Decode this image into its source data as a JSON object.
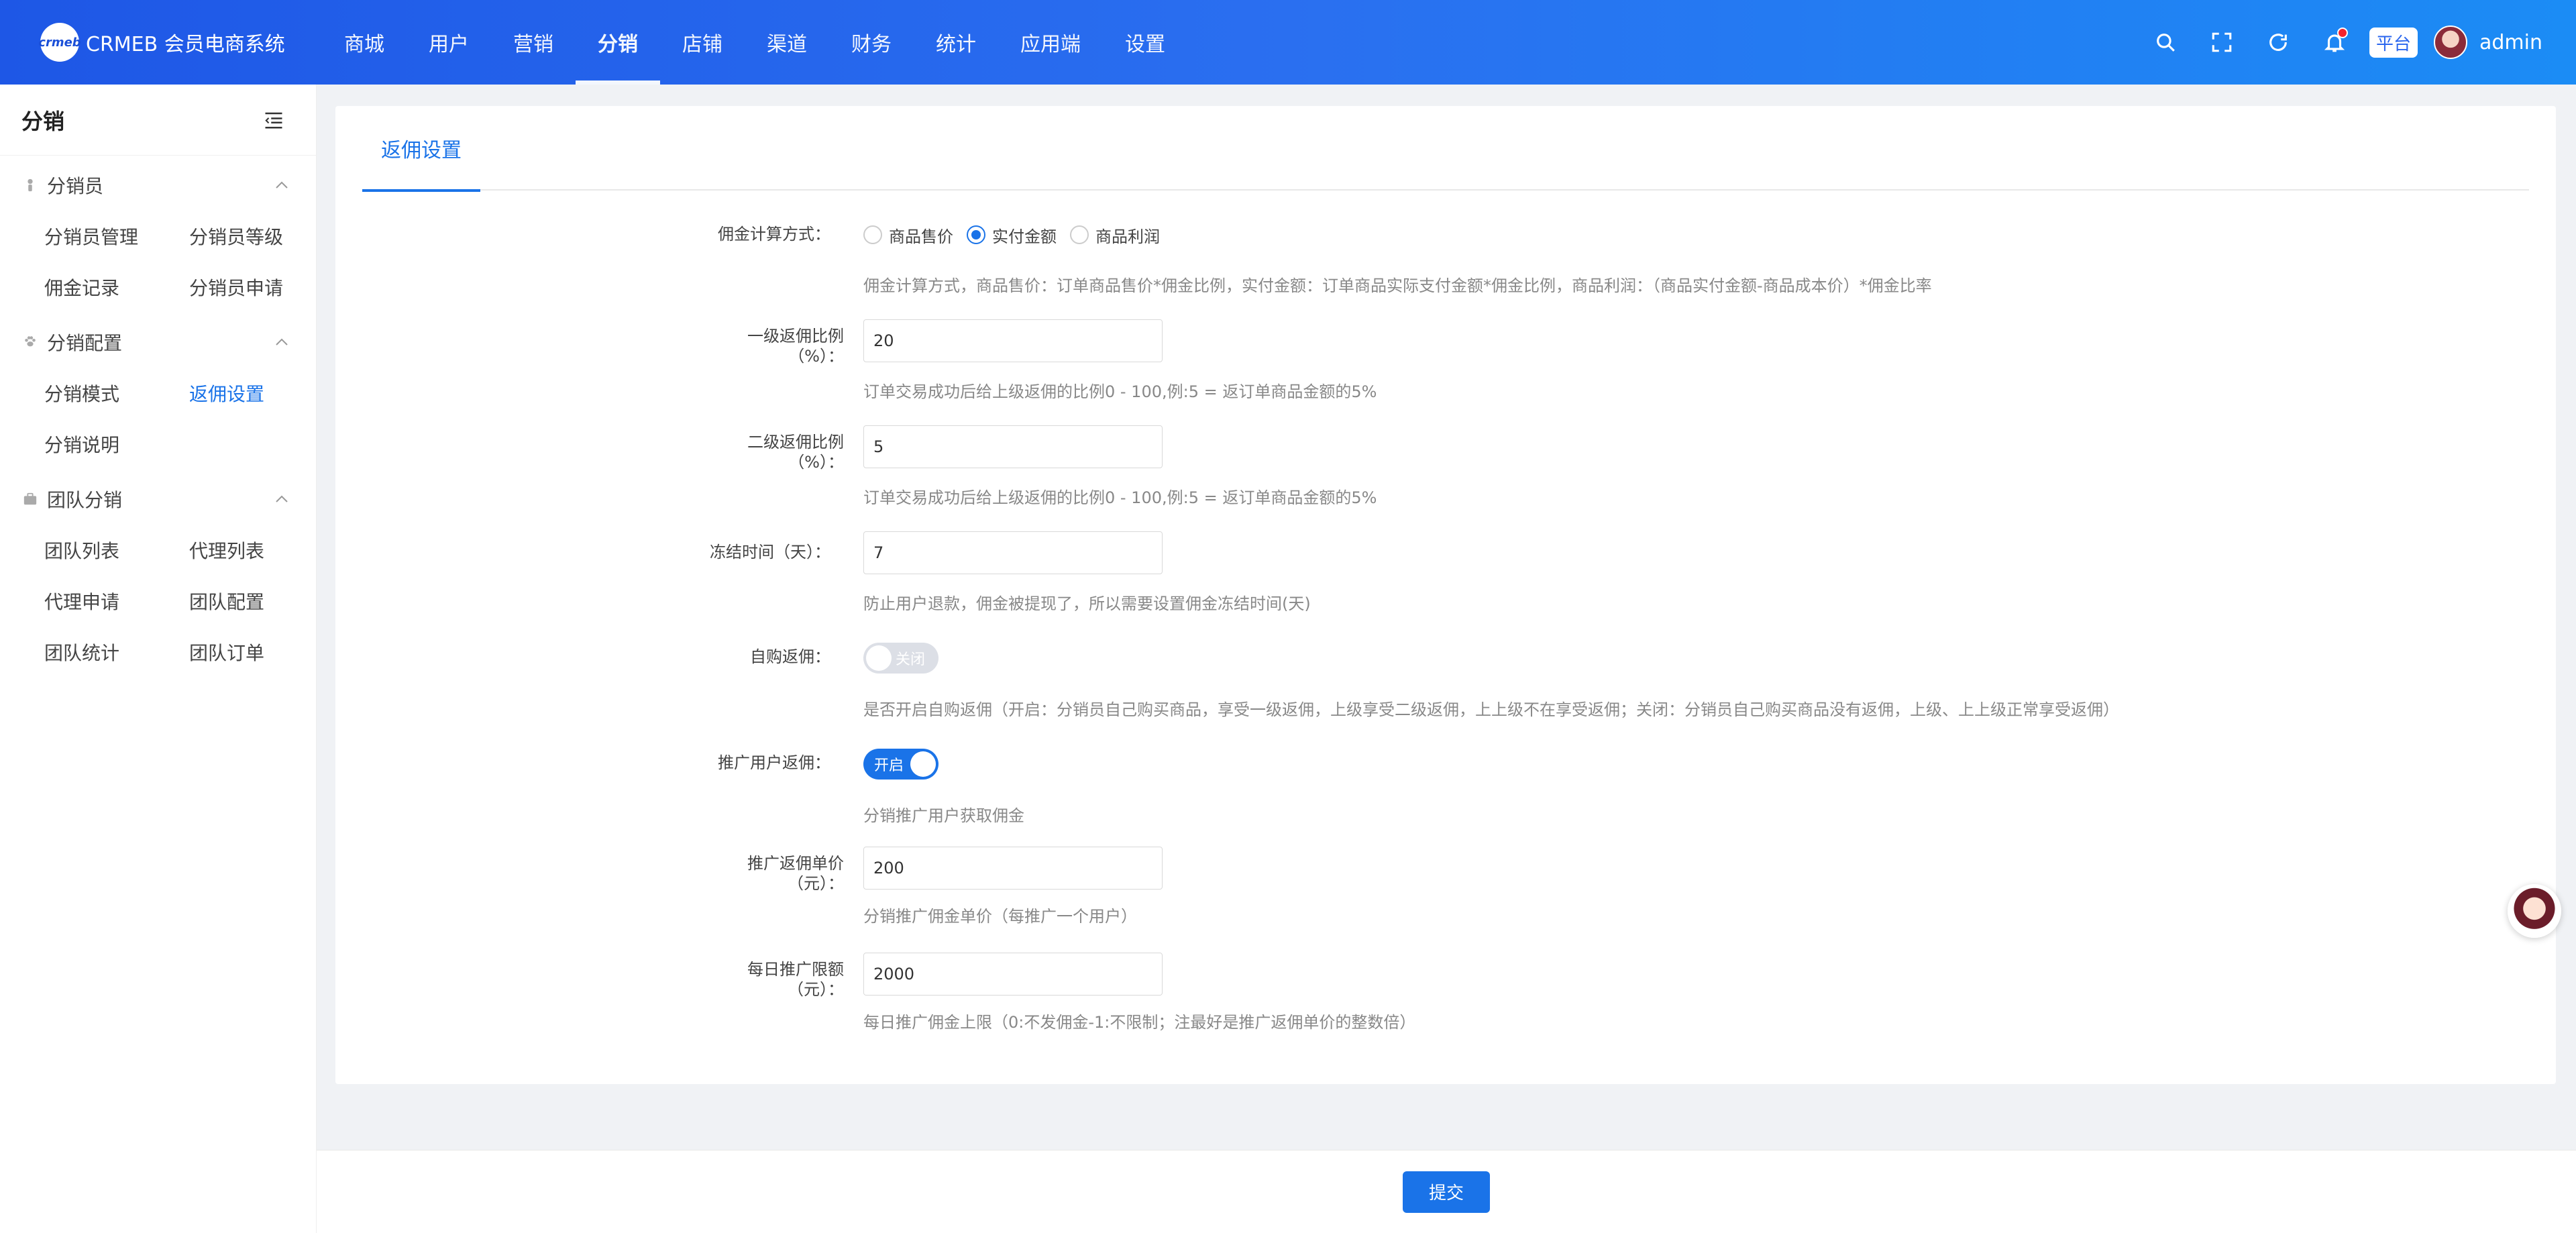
{
  "header": {
    "logo_mark": "crmeb",
    "logo_text": "CRMEB 会员电商系统",
    "nav": [
      "商城",
      "用户",
      "营销",
      "分销",
      "店铺",
      "渠道",
      "财务",
      "统计",
      "应用端",
      "设置"
    ],
    "active_nav": "分销",
    "platform_label": "平台",
    "username": "admin"
  },
  "sidebar": {
    "title": "分销",
    "groups": [
      {
        "label": "分销员",
        "items": [
          "分销员管理",
          "分销员等级",
          "佣金记录",
          "分销员申请"
        ]
      },
      {
        "label": "分销配置",
        "items": [
          "分销模式",
          "返佣设置",
          "分销说明"
        ]
      },
      {
        "label": "团队分销",
        "items": [
          "团队列表",
          "代理列表",
          "代理申请",
          "团队配置",
          "团队统计",
          "团队订单"
        ]
      }
    ],
    "active_item": "返佣设置"
  },
  "tab": {
    "label": "返佣设置"
  },
  "form": {
    "calc_method": {
      "label": "佣金计算方式：",
      "options": [
        "商品售价",
        "实付金额",
        "商品利润"
      ],
      "selected": "实付金额",
      "help": "佣金计算方式，商品售价：订单商品售价*佣金比例，实付金额：订单商品实际支付金额*佣金比例，商品利润：（商品实付金额-商品成本价）*佣金比率"
    },
    "level1": {
      "label": "一级返佣比例（%）：",
      "value": "20",
      "help": "订单交易成功后给上级返佣的比例0 - 100,例:5 = 返订单商品金额的5%"
    },
    "level2": {
      "label": "二级返佣比例（%）：",
      "value": "5",
      "help": "订单交易成功后给上级返佣的比例0 - 100,例:5 = 返订单商品金额的5%"
    },
    "freeze": {
      "label": "冻结时间（天）：",
      "value": "7",
      "help": "防止用户退款，佣金被提现了，所以需要设置佣金冻结时间(天)"
    },
    "self_buy": {
      "label": "自购返佣：",
      "state": "关闭",
      "help": "是否开启自购返佣（开启：分销员自己购买商品，享受一级返佣，上级享受二级返佣，上上级不在享受返佣；关闭：分销员自己购买商品没有返佣，上级、上上级正常享受返佣）"
    },
    "promo": {
      "label": "推广用户返佣：",
      "state": "开启",
      "help": "分销推广用户获取佣金"
    },
    "unit_price": {
      "label": "推广返佣单价（元）：",
      "value": "200",
      "help": "分销推广佣金单价（每推广一个用户）"
    },
    "daily_limit": {
      "label": "每日推广限额（元）：",
      "value": "2000",
      "help": "每日推广佣金上限（0:不发佣金-1:不限制；注最好是推广返佣单价的整数倍）"
    }
  },
  "footer": {
    "submit_label": "提交"
  },
  "colors": {
    "primary": "#1a73e8",
    "header_start": "#1e57e6",
    "header_end": "#1b8cf5"
  }
}
